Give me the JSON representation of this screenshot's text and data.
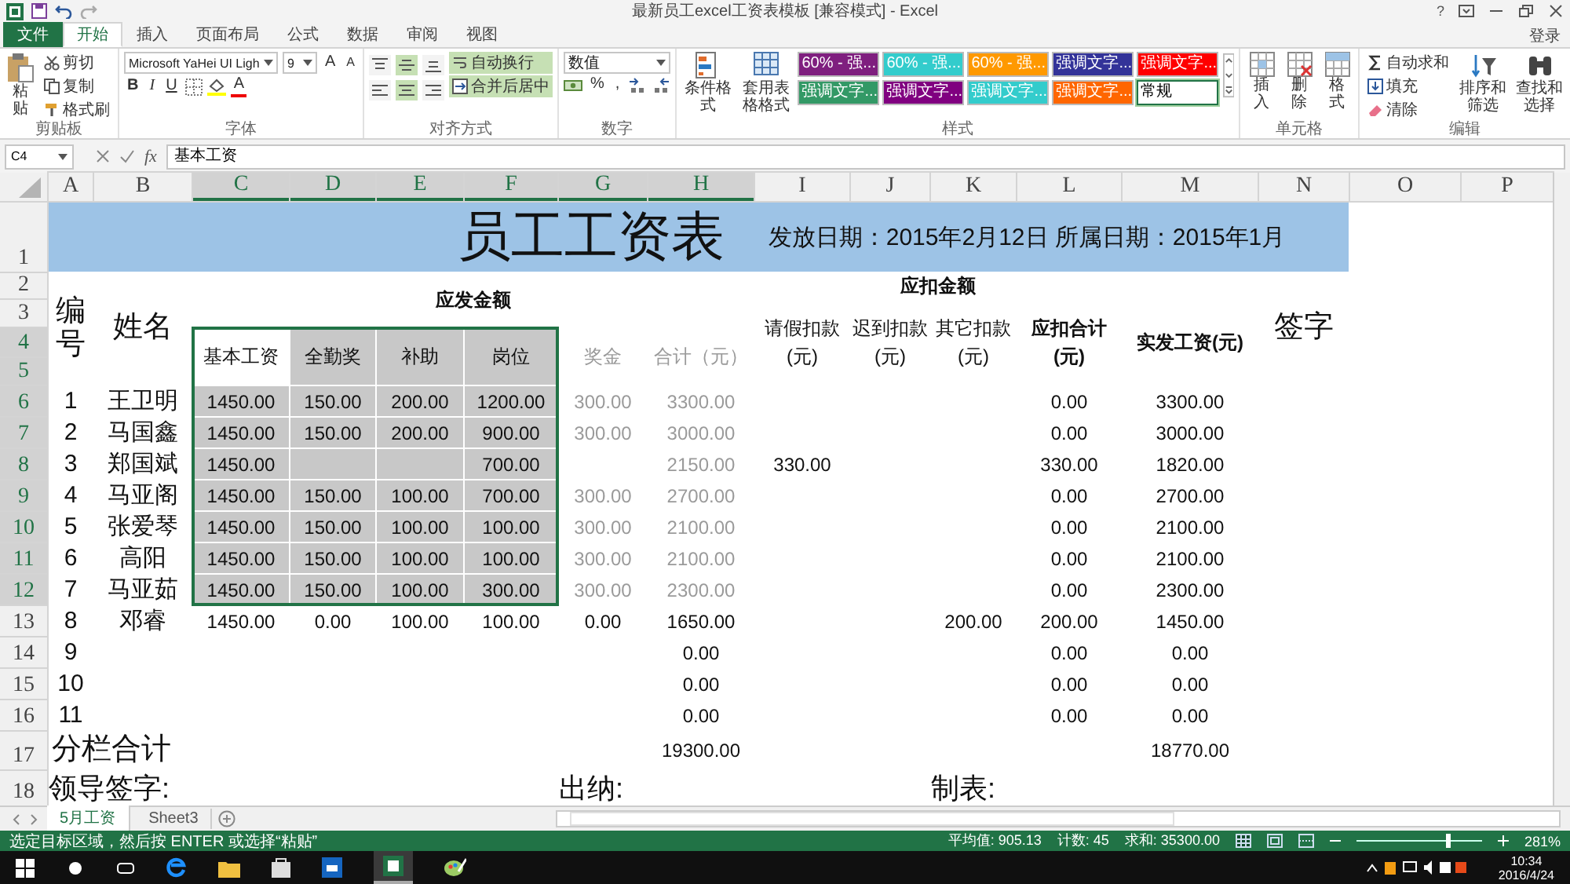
{
  "window": {
    "title": "最新员工excel工资表模板 [兼容模式] - Excel",
    "help": "?",
    "sign_in": "登录"
  },
  "ribbon": {
    "file_tab": "文件",
    "tabs": [
      {
        "label": "开始",
        "selected": true
      },
      {
        "label": "插入",
        "selected": false
      },
      {
        "label": "页面布局",
        "selected": false
      },
      {
        "label": "公式",
        "selected": false
      },
      {
        "label": "数据",
        "selected": false
      },
      {
        "label": "审阅",
        "selected": false
      },
      {
        "label": "视图",
        "selected": false
      }
    ],
    "clipboard": {
      "label": "剪贴板",
      "paste": "粘贴",
      "items": [
        "剪切",
        "复制",
        "格式刷"
      ]
    },
    "font": {
      "label": "字体",
      "name": "Microsoft YaHei UI Ligh",
      "size": "9",
      "grow": [
        "A",
        "A"
      ],
      "styles": [
        "B",
        "I",
        "U"
      ],
      "color_letter": "A"
    },
    "alignment": {
      "label": "对齐方式",
      "align_buttons": [
        {
          "kind": "top",
          "on": false
        },
        {
          "kind": "middle",
          "on": true
        },
        {
          "kind": "bottom",
          "on": false
        },
        {
          "kind": "left",
          "on": false
        },
        {
          "kind": "center",
          "on": true
        },
        {
          "kind": "right",
          "on": false
        }
      ],
      "wrap": {
        "text": "自动换行",
        "on": true
      },
      "merge": {
        "text": "合并后居中",
        "on": true
      }
    },
    "number": {
      "label": "数字",
      "format": "数值",
      "symbols": [
        "%",
        ","
      ]
    },
    "styles": {
      "label": "样式",
      "buttons": [
        "条件格式",
        "套用表格格式"
      ],
      "chips": [
        {
          "text": "60% - 强...",
          "color": "#7f1f7f",
          "selected": false
        },
        {
          "text": "60% - 强...",
          "color": "#33cccc",
          "selected": false
        },
        {
          "text": "60% - 强...",
          "color": "#ff9900",
          "selected": false
        },
        {
          "text": "强调文字...",
          "color": "#333399",
          "selected": false
        },
        {
          "text": "强调文字...",
          "color": "#ff0000",
          "selected": false
        },
        {
          "text": "强调文字...",
          "color": "#339966",
          "selected": false
        },
        {
          "text": "强调文字...",
          "color": "#800080",
          "selected": false
        },
        {
          "text": "强调文字...",
          "color": "#33cccc",
          "selected": false
        },
        {
          "text": "强调文字...",
          "color": "#ff6600",
          "selected": false
        },
        {
          "text": "常规",
          "color": "#ffffff",
          "selected": true
        }
      ]
    },
    "cells": {
      "label": "单元格",
      "buttons": [
        "插入",
        "删除",
        "格式"
      ]
    },
    "editing": {
      "label": "编辑",
      "items": [
        "自动求和",
        "填充",
        "清除"
      ],
      "buttons": [
        "排序和筛选",
        "查找和选择"
      ]
    }
  },
  "formula_bar": {
    "name_box": "C4",
    "function_label": "fx",
    "formula": "基本工资"
  },
  "sheet": {
    "columns": [
      {
        "label": "A",
        "selected": false
      },
      {
        "label": "B",
        "selected": false
      },
      {
        "label": "C",
        "selected": true
      },
      {
        "label": "D",
        "selected": true
      },
      {
        "label": "E",
        "selected": true
      },
      {
        "label": "F",
        "selected": true
      },
      {
        "label": "G",
        "selected": true
      },
      {
        "label": "H",
        "selected": true
      },
      {
        "label": "I",
        "selected": false
      },
      {
        "label": "J",
        "selected": false
      },
      {
        "label": "K",
        "selected": false
      },
      {
        "label": "L",
        "selected": false
      },
      {
        "label": "M",
        "selected": false
      },
      {
        "label": "N",
        "selected": false
      },
      {
        "label": "O",
        "selected": false
      },
      {
        "label": "P",
        "selected": false
      }
    ],
    "row_numbers": [
      {
        "label": "1",
        "selected": false
      },
      {
        "label": "2",
        "selected": false
      },
      {
        "label": "3",
        "selected": false
      },
      {
        "label": "4",
        "selected": true
      },
      {
        "label": "5",
        "selected": true
      },
      {
        "label": "6",
        "selected": true
      },
      {
        "label": "7",
        "selected": true
      },
      {
        "label": "8",
        "selected": true
      },
      {
        "label": "9",
        "selected": true
      },
      {
        "label": "10",
        "selected": true
      },
      {
        "label": "11",
        "selected": true
      },
      {
        "label": "12",
        "selected": true
      },
      {
        "label": "13",
        "selected": false
      },
      {
        "label": "14",
        "selected": false
      },
      {
        "label": "15",
        "selected": false
      },
      {
        "label": "16",
        "selected": false
      },
      {
        "label": "17",
        "selected": false
      },
      {
        "label": "18",
        "selected": false
      }
    ],
    "title": "员工工资表",
    "dates": "发放日期：2015年2月12日 所属日期：2015年1月",
    "headers": {
      "number": "编号",
      "name": "姓名",
      "earn_group": "应发金额",
      "deduct_group": "应扣金额",
      "sign": "签字",
      "earn": [
        {
          "text": "基本工资",
          "selected": false,
          "faded": false
        },
        {
          "text": "全勤奖",
          "selected": true,
          "faded": false
        },
        {
          "text": "补助",
          "selected": true,
          "faded": false
        },
        {
          "text": "岗位",
          "selected": true,
          "faded": false
        },
        {
          "text": "奖金",
          "selected": false,
          "faded": true
        },
        {
          "text": "合计（元）",
          "selected": false,
          "faded": true
        }
      ],
      "deduct": [
        {
          "text": "请假扣款(元)",
          "emphasis": false
        },
        {
          "text": "迟到扣款(元)",
          "emphasis": false
        },
        {
          "text": "其它扣款(元)",
          "emphasis": false
        },
        {
          "text": "应扣合计(元)",
          "emphasis": true
        },
        {
          "text": "实发工资(元)",
          "emphasis": true
        }
      ]
    },
    "rows": [
      {
        "no": "1",
        "name": "王卫明",
        "selected": true,
        "values": {
          "C": "1450.00",
          "D": "150.00",
          "E": "200.00",
          "F": "1200.00",
          "G": "300.00",
          "H": "3300.00",
          "L": "0.00",
          "M": "3300.00"
        }
      },
      {
        "no": "2",
        "name": "马国鑫",
        "selected": true,
        "values": {
          "C": "1450.00",
          "D": "150.00",
          "E": "200.00",
          "F": "900.00",
          "G": "300.00",
          "H": "3000.00",
          "L": "0.00",
          "M": "3000.00"
        }
      },
      {
        "no": "3",
        "name": "郑国斌",
        "selected": true,
        "values": {
          "C": "1450.00",
          "F": "700.00",
          "H": "2150.00",
          "I": "330.00",
          "L": "330.00",
          "M": "1820.00"
        }
      },
      {
        "no": "4",
        "name": "马亚阁",
        "selected": true,
        "values": {
          "C": "1450.00",
          "D": "150.00",
          "E": "100.00",
          "F": "700.00",
          "G": "300.00",
          "H": "2700.00",
          "L": "0.00",
          "M": "2700.00"
        }
      },
      {
        "no": "5",
        "name": "张爱琴",
        "selected": true,
        "values": {
          "C": "1450.00",
          "D": "150.00",
          "E": "100.00",
          "F": "100.00",
          "G": "300.00",
          "H": "2100.00",
          "L": "0.00",
          "M": "2100.00"
        }
      },
      {
        "no": "6",
        "name": "高阳",
        "selected": true,
        "values": {
          "C": "1450.00",
          "D": "150.00",
          "E": "100.00",
          "F": "100.00",
          "G": "300.00",
          "H": "2100.00",
          "L": "0.00",
          "M": "2100.00"
        }
      },
      {
        "no": "7",
        "name": "马亚茹",
        "selected": true,
        "values": {
          "C": "1450.00",
          "D": "150.00",
          "E": "100.00",
          "F": "300.00",
          "G": "300.00",
          "H": "2300.00",
          "L": "0.00",
          "M": "2300.00"
        }
      },
      {
        "no": "8",
        "name": "邓睿",
        "selected": false,
        "values": {
          "C": "1450.00",
          "D": "0.00",
          "E": "100.00",
          "F": "100.00",
          "G": "0.00",
          "H": "1650.00",
          "K": "200.00",
          "L": "200.00",
          "M": "1450.00"
        }
      },
      {
        "no": "9",
        "selected": false,
        "values": {
          "H": "0.00",
          "L": "0.00",
          "M": "0.00"
        }
      },
      {
        "no": "10",
        "selected": false,
        "values": {
          "H": "0.00",
          "L": "0.00",
          "M": "0.00"
        }
      },
      {
        "no": "11",
        "selected": false,
        "values": {
          "H": "0.00",
          "L": "0.00",
          "M": "0.00"
        }
      }
    ],
    "total": {
      "label": "分栏合计",
      "earned": "19300.00",
      "paid": "18770.00"
    },
    "signatures": [
      "领导签字:",
      "出纳:",
      "制表:"
    ],
    "tabs": [
      {
        "label": "5月工资",
        "selected": true
      },
      {
        "label": "Sheet3",
        "selected": false
      }
    ]
  },
  "status_bar": {
    "message": "选定目标区域，然后按 ENTER 或选择“粘贴”",
    "stats": [
      "平均值: 905.13",
      "计数: 45",
      "求和: 35300.00"
    ],
    "zoom": {
      "level": 0.72,
      "reading": "281%"
    }
  },
  "taskbar": {
    "time": "10:34",
    "date": "2016/4/24"
  }
}
